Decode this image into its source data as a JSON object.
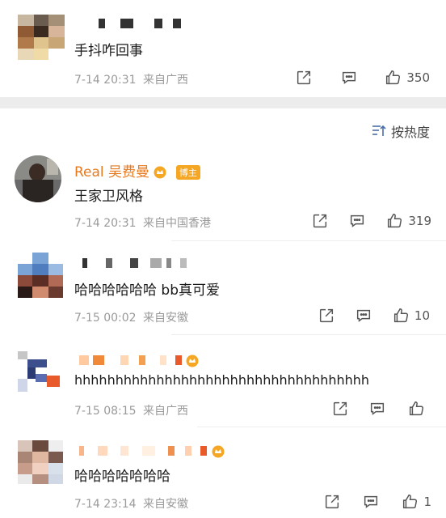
{
  "sort": {
    "label": "按热度"
  },
  "comments": [
    {
      "name": "",
      "text": "手抖咋回事",
      "date": "7-14 20:31",
      "location": "来自广西",
      "likes": "350"
    },
    {
      "name": "Real 吴费曼",
      "badge": "博主",
      "text": "王家卫风格",
      "date": "7-14 20:31",
      "location": "来自中国香港",
      "likes": "319"
    },
    {
      "name": "",
      "text": "哈哈哈哈哈哈 bb真可爱",
      "date": "7-15 00:02",
      "location": "来自安徽",
      "likes": "10"
    },
    {
      "name": "",
      "text": "hhhhhhhhhhhhhhhhhhhhhhhhhhhhhhhhhhhh",
      "date": "7-15 08:15",
      "location": "来自广西",
      "likes": ""
    },
    {
      "name": "",
      "text": "哈哈哈哈哈哈哈",
      "date": "7-14 23:14",
      "location": "来自安徽",
      "likes": "1"
    }
  ],
  "colors": {
    "blogger_name": "#e8791c",
    "badge_bg": "#f5a623",
    "meta": "#9a9a9a",
    "band": "#ececec"
  },
  "icons": [
    "share-icon",
    "comment-icon",
    "like-icon",
    "sort-icon",
    "crown-icon"
  ]
}
